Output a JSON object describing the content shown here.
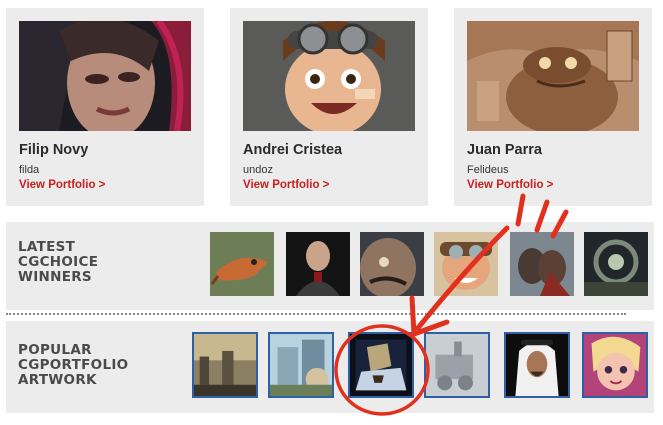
{
  "artists": [
    {
      "name": "Filip Novy",
      "handle": "filda",
      "link": "View Portfolio >"
    },
    {
      "name": "Andrei Cristea",
      "handle": "undoz",
      "link": "View Portfolio >"
    },
    {
      "name": "Juan Parra",
      "handle": "Felideus",
      "link": "View Portfolio >"
    }
  ],
  "latest": {
    "title_lines": [
      "LATEST",
      "CGCHOICE",
      "WINNERS"
    ]
  },
  "popular": {
    "title_lines": [
      "POPULAR",
      "CGPORTFOLIO",
      "ARTWORK"
    ]
  },
  "colors": {
    "link_red": "#c8201e",
    "annotation_red": "#e2301f",
    "thumb_border_blue": "#2f5fa5",
    "panel_grey": "#ececec"
  }
}
